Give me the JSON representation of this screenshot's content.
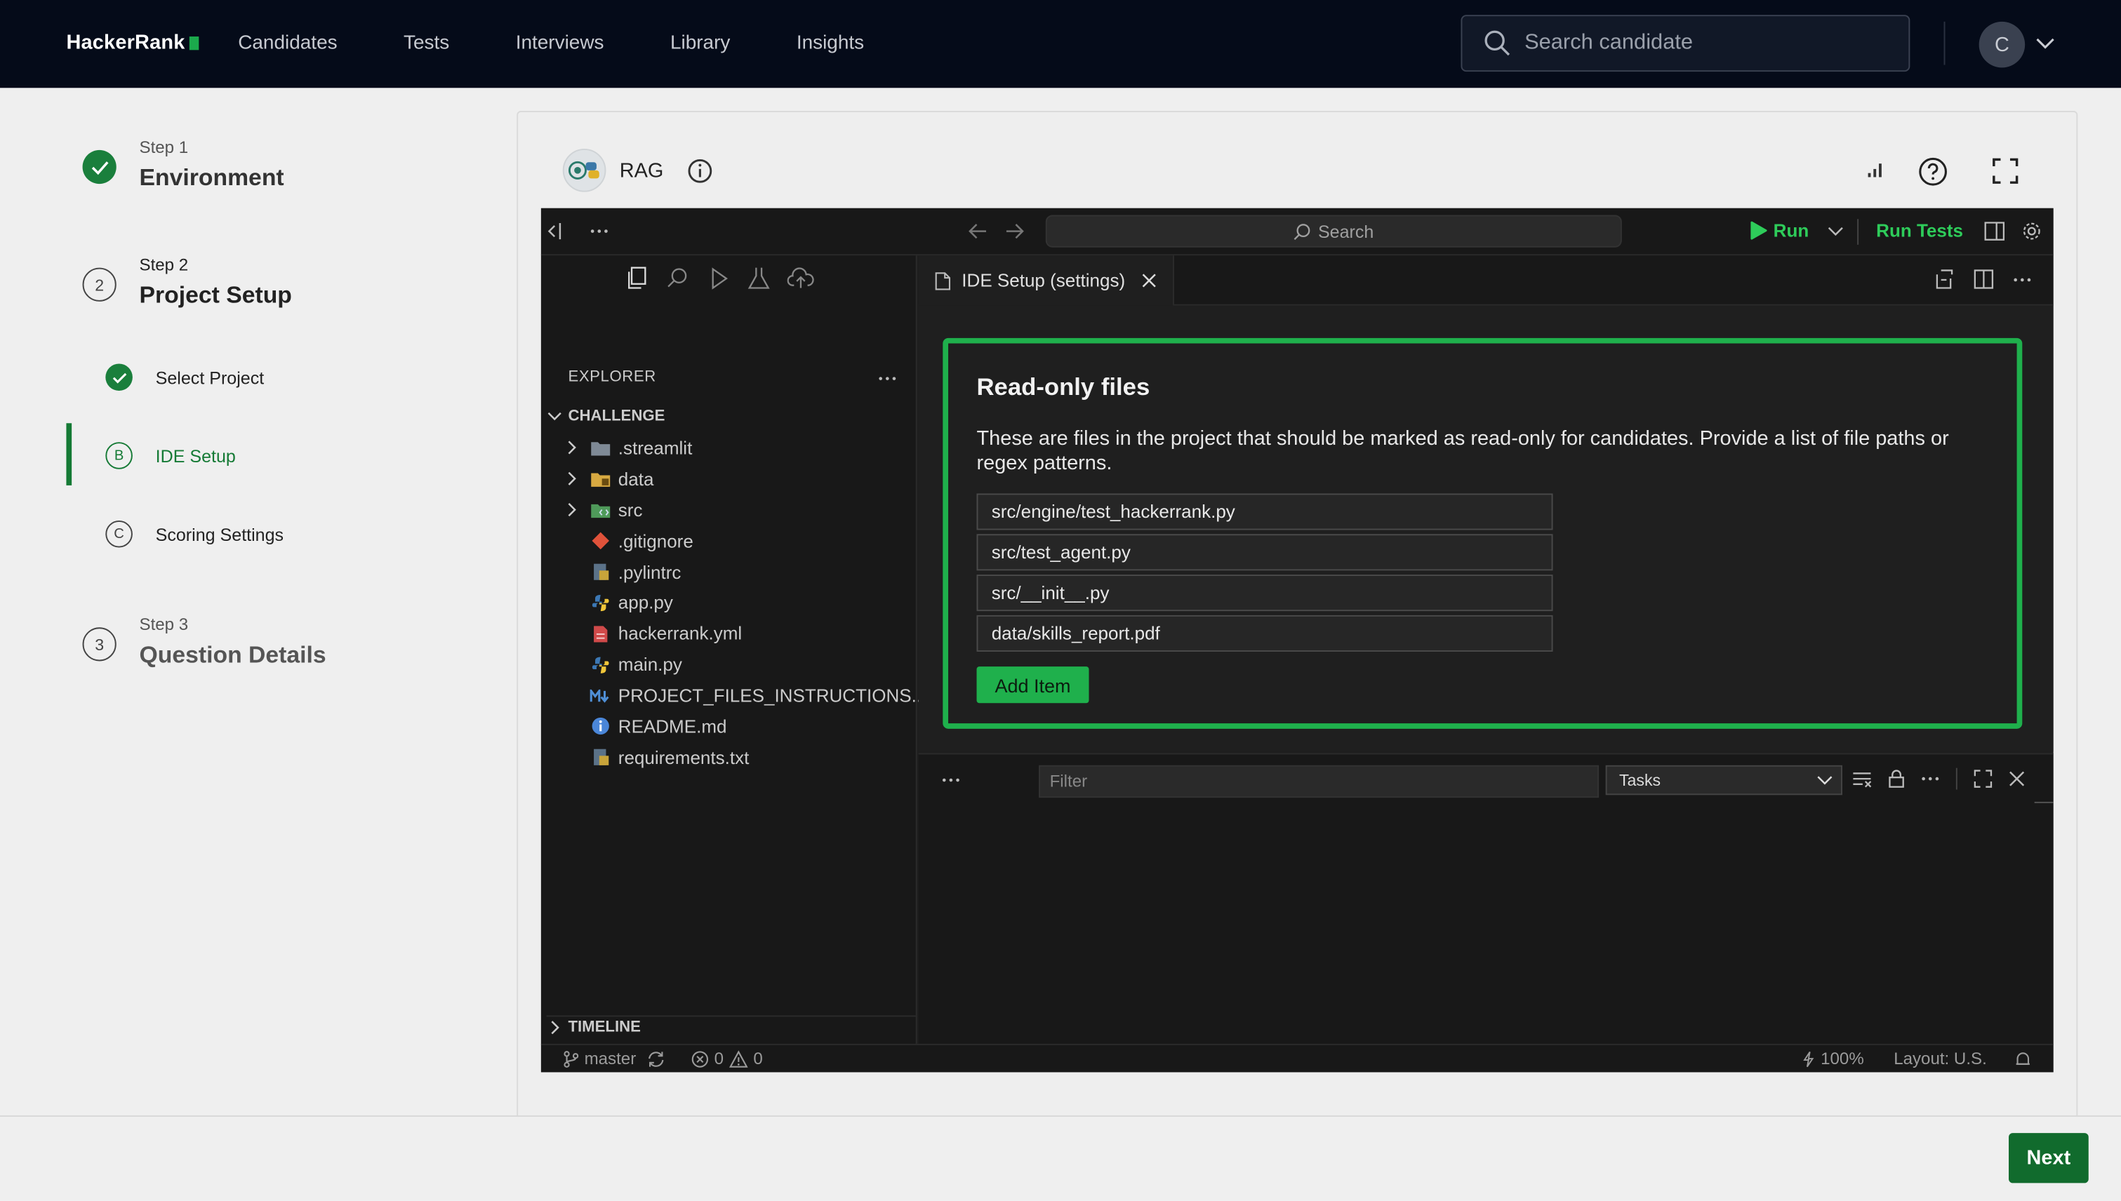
{
  "nav": {
    "logo": "HackerRank",
    "links": [
      "Candidates",
      "Tests",
      "Interviews",
      "Library",
      "Insights"
    ],
    "search_placeholder": "Search candidate",
    "avatar_initial": "C"
  },
  "stepper": {
    "step1_label": "Step 1",
    "step1_title": "Environment",
    "step2_label": "Step 2",
    "step2_number": "2",
    "step2_title": "Project Setup",
    "sub_select_project": "Select Project",
    "sub_ide_setup_marker": "B",
    "sub_ide_setup": "IDE Setup",
    "sub_scoring_marker": "C",
    "sub_scoring": "Scoring Settings",
    "step3_label": "Step 3",
    "step3_number": "3",
    "step3_title": "Question Details"
  },
  "card": {
    "title": "RAG"
  },
  "ide": {
    "search": "Search",
    "run": "Run",
    "run_tests": "Run Tests",
    "explorer": "EXPLORER",
    "folder": "CHALLENGE",
    "files": [
      {
        "name": ".streamlit",
        "type": "folder",
        "icon": "folder-icon"
      },
      {
        "name": "data",
        "type": "folder",
        "icon": "folder-data-icon"
      },
      {
        "name": "src",
        "type": "folder",
        "icon": "folder-src-icon"
      },
      {
        "name": ".gitignore",
        "type": "file",
        "icon": "git-icon"
      },
      {
        "name": ".pylintrc",
        "type": "file",
        "icon": "config-icon"
      },
      {
        "name": "app.py",
        "type": "file",
        "icon": "python-icon"
      },
      {
        "name": "hackerrank.yml",
        "type": "file",
        "icon": "yaml-icon"
      },
      {
        "name": "main.py",
        "type": "file",
        "icon": "python-icon"
      },
      {
        "name": "PROJECT_FILES_INSTRUCTIONS...",
        "type": "file",
        "icon": "markdown-icon"
      },
      {
        "name": "README.md",
        "type": "file",
        "icon": "info-icon"
      },
      {
        "name": "requirements.txt",
        "type": "file",
        "icon": "config-icon"
      }
    ],
    "timeline": "TIMELINE",
    "tab": "IDE Setup (settings)",
    "readonly": {
      "title": "Read-only files",
      "description": "These are files in the project that should be marked as read-only for candidates. Provide a list of file paths or regex patterns.",
      "items": [
        "src/engine/test_hackerrank.py",
        "src/test_agent.py",
        "src/__init__.py",
        "data/skills_report.pdf"
      ],
      "add_button": "Add Item"
    },
    "panel": {
      "filter_placeholder": "Filter",
      "tasks": "Tasks"
    },
    "status": {
      "branch": "master",
      "errors": "0",
      "warnings": "0",
      "zoom": "100%",
      "layout": "Layout: U.S."
    }
  },
  "footer": {
    "next": "Next"
  },
  "colors": {
    "accent_green": "#1fb04c",
    "brand_green": "#1a7f3c",
    "nav_bg": "#050b19"
  }
}
